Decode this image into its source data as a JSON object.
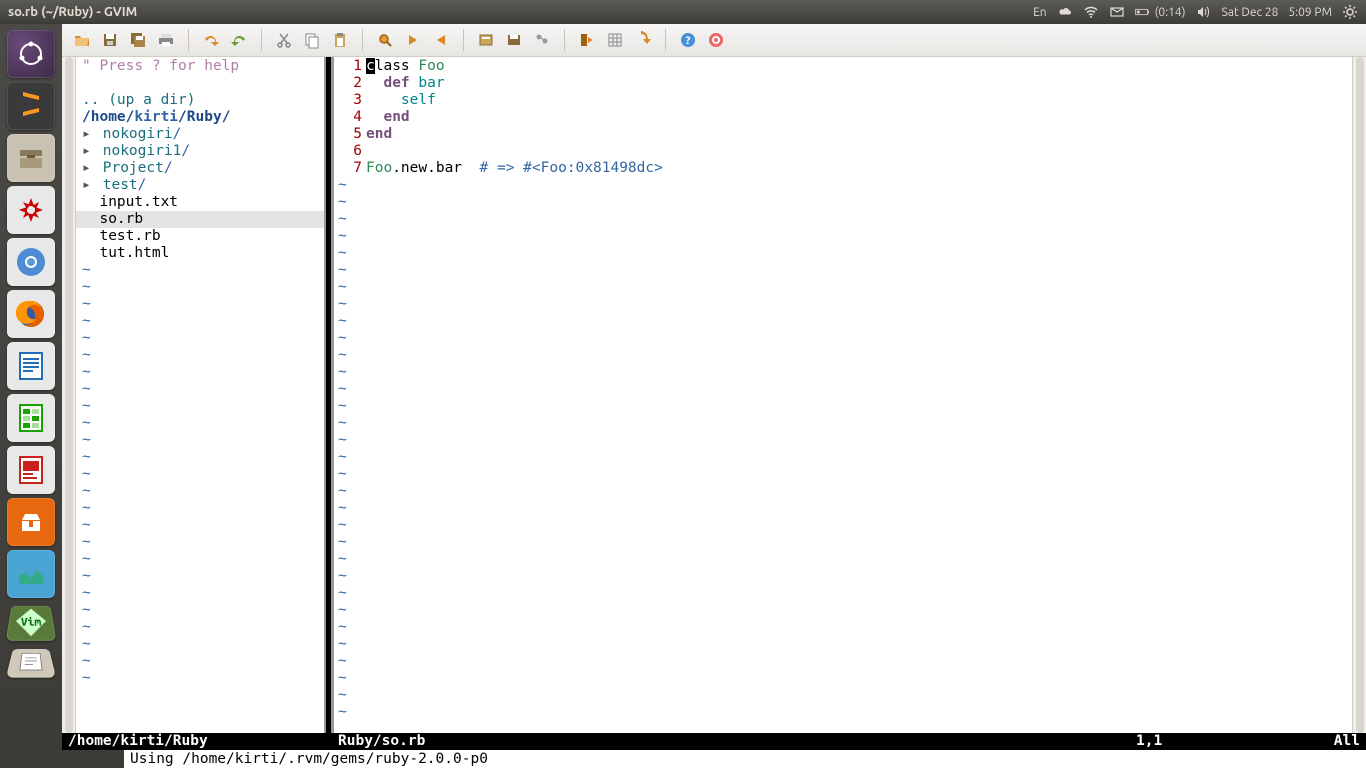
{
  "titlebar": {
    "title": "so.rb (~/Ruby) - GVIM",
    "lang": "En",
    "battery": "(0:14)",
    "date": "Sat Dec 28",
    "time": "5:09 PM"
  },
  "netrw": {
    "help": "\" Press ? for help",
    "updir": ".. (up a dir)",
    "path_prefix": "/home/",
    "path_user": "kirti",
    "path_rest": "/Ruby/",
    "dirs": [
      {
        "name": "nokogiri",
        "sep": "/"
      },
      {
        "name": "nokogiri1",
        "sep": "/"
      },
      {
        "name": "Project",
        "sep": "/"
      },
      {
        "name": "test",
        "sep": "/"
      }
    ],
    "files": [
      "input.txt",
      "so.rb",
      "test.rb",
      "tut.html"
    ],
    "selected_file": "so.rb"
  },
  "code": {
    "lines": [
      {
        "num": "1",
        "html": "<span class=\"cursor-block\">c</span>lass <span class=\"kw-const\">Foo</span>"
      },
      {
        "num": "2",
        "html": "  <span class=\"kw-magenta\">def</span> <span class=\"kw-cyan\">bar</span>"
      },
      {
        "num": "3",
        "html": "    <span class=\"kw-cyan\">self</span>"
      },
      {
        "num": "4",
        "html": "  <span class=\"kw-magenta\">end</span>"
      },
      {
        "num": "5",
        "html": "<span class=\"kw-magenta\">end</span>"
      },
      {
        "num": "6",
        "html": ""
      },
      {
        "num": "7",
        "html": "<span class=\"kw-const\">Foo</span>.new.bar  <span class=\"kw-comment\"># =&gt; #&lt;Foo:0x81498dc&gt;</span>"
      }
    ],
    "tilde_count": 32
  },
  "status": {
    "left": "/home/kirti/Ruby",
    "file": "Ruby/so.rb",
    "pos": "1,1",
    "pct": "All"
  },
  "cmdline": "Using /home/kirti/.rvm/gems/ruby-2.0.0-p0",
  "netrw_tilde_count": 25
}
